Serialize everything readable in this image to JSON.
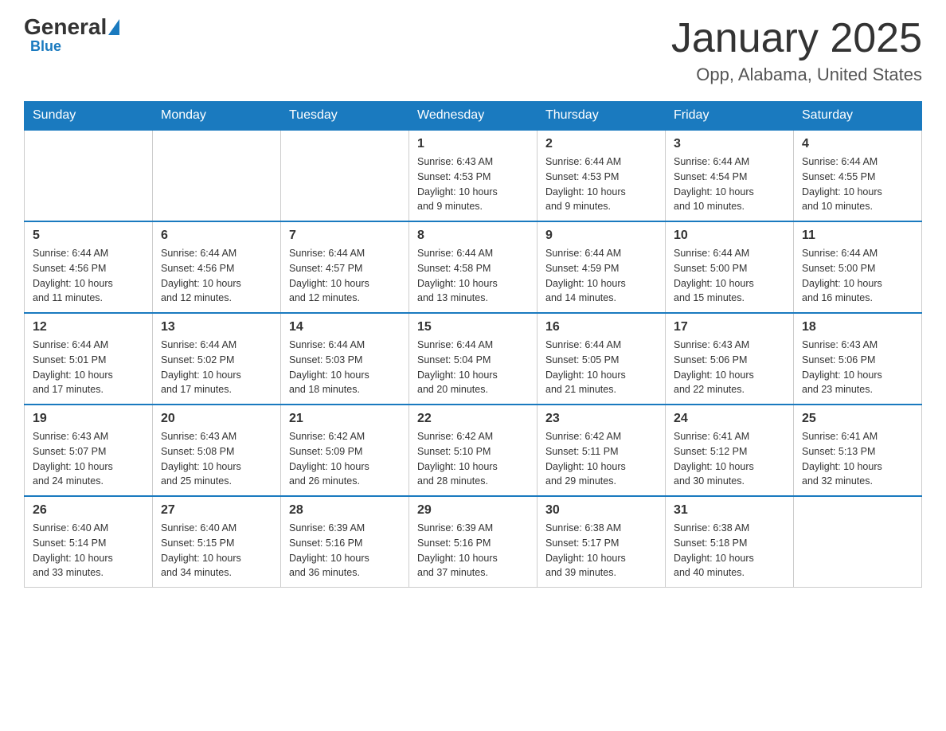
{
  "header": {
    "logo": {
      "general": "General",
      "blue": "Blue"
    },
    "title": "January 2025",
    "subtitle": "Opp, Alabama, United States"
  },
  "days_of_week": [
    "Sunday",
    "Monday",
    "Tuesday",
    "Wednesday",
    "Thursday",
    "Friday",
    "Saturday"
  ],
  "weeks": [
    [
      {
        "day": "",
        "info": ""
      },
      {
        "day": "",
        "info": ""
      },
      {
        "day": "",
        "info": ""
      },
      {
        "day": "1",
        "info": "Sunrise: 6:43 AM\nSunset: 4:53 PM\nDaylight: 10 hours\nand 9 minutes."
      },
      {
        "day": "2",
        "info": "Sunrise: 6:44 AM\nSunset: 4:53 PM\nDaylight: 10 hours\nand 9 minutes."
      },
      {
        "day": "3",
        "info": "Sunrise: 6:44 AM\nSunset: 4:54 PM\nDaylight: 10 hours\nand 10 minutes."
      },
      {
        "day": "4",
        "info": "Sunrise: 6:44 AM\nSunset: 4:55 PM\nDaylight: 10 hours\nand 10 minutes."
      }
    ],
    [
      {
        "day": "5",
        "info": "Sunrise: 6:44 AM\nSunset: 4:56 PM\nDaylight: 10 hours\nand 11 minutes."
      },
      {
        "day": "6",
        "info": "Sunrise: 6:44 AM\nSunset: 4:56 PM\nDaylight: 10 hours\nand 12 minutes."
      },
      {
        "day": "7",
        "info": "Sunrise: 6:44 AM\nSunset: 4:57 PM\nDaylight: 10 hours\nand 12 minutes."
      },
      {
        "day": "8",
        "info": "Sunrise: 6:44 AM\nSunset: 4:58 PM\nDaylight: 10 hours\nand 13 minutes."
      },
      {
        "day": "9",
        "info": "Sunrise: 6:44 AM\nSunset: 4:59 PM\nDaylight: 10 hours\nand 14 minutes."
      },
      {
        "day": "10",
        "info": "Sunrise: 6:44 AM\nSunset: 5:00 PM\nDaylight: 10 hours\nand 15 minutes."
      },
      {
        "day": "11",
        "info": "Sunrise: 6:44 AM\nSunset: 5:00 PM\nDaylight: 10 hours\nand 16 minutes."
      }
    ],
    [
      {
        "day": "12",
        "info": "Sunrise: 6:44 AM\nSunset: 5:01 PM\nDaylight: 10 hours\nand 17 minutes."
      },
      {
        "day": "13",
        "info": "Sunrise: 6:44 AM\nSunset: 5:02 PM\nDaylight: 10 hours\nand 17 minutes."
      },
      {
        "day": "14",
        "info": "Sunrise: 6:44 AM\nSunset: 5:03 PM\nDaylight: 10 hours\nand 18 minutes."
      },
      {
        "day": "15",
        "info": "Sunrise: 6:44 AM\nSunset: 5:04 PM\nDaylight: 10 hours\nand 20 minutes."
      },
      {
        "day": "16",
        "info": "Sunrise: 6:44 AM\nSunset: 5:05 PM\nDaylight: 10 hours\nand 21 minutes."
      },
      {
        "day": "17",
        "info": "Sunrise: 6:43 AM\nSunset: 5:06 PM\nDaylight: 10 hours\nand 22 minutes."
      },
      {
        "day": "18",
        "info": "Sunrise: 6:43 AM\nSunset: 5:06 PM\nDaylight: 10 hours\nand 23 minutes."
      }
    ],
    [
      {
        "day": "19",
        "info": "Sunrise: 6:43 AM\nSunset: 5:07 PM\nDaylight: 10 hours\nand 24 minutes."
      },
      {
        "day": "20",
        "info": "Sunrise: 6:43 AM\nSunset: 5:08 PM\nDaylight: 10 hours\nand 25 minutes."
      },
      {
        "day": "21",
        "info": "Sunrise: 6:42 AM\nSunset: 5:09 PM\nDaylight: 10 hours\nand 26 minutes."
      },
      {
        "day": "22",
        "info": "Sunrise: 6:42 AM\nSunset: 5:10 PM\nDaylight: 10 hours\nand 28 minutes."
      },
      {
        "day": "23",
        "info": "Sunrise: 6:42 AM\nSunset: 5:11 PM\nDaylight: 10 hours\nand 29 minutes."
      },
      {
        "day": "24",
        "info": "Sunrise: 6:41 AM\nSunset: 5:12 PM\nDaylight: 10 hours\nand 30 minutes."
      },
      {
        "day": "25",
        "info": "Sunrise: 6:41 AM\nSunset: 5:13 PM\nDaylight: 10 hours\nand 32 minutes."
      }
    ],
    [
      {
        "day": "26",
        "info": "Sunrise: 6:40 AM\nSunset: 5:14 PM\nDaylight: 10 hours\nand 33 minutes."
      },
      {
        "day": "27",
        "info": "Sunrise: 6:40 AM\nSunset: 5:15 PM\nDaylight: 10 hours\nand 34 minutes."
      },
      {
        "day": "28",
        "info": "Sunrise: 6:39 AM\nSunset: 5:16 PM\nDaylight: 10 hours\nand 36 minutes."
      },
      {
        "day": "29",
        "info": "Sunrise: 6:39 AM\nSunset: 5:16 PM\nDaylight: 10 hours\nand 37 minutes."
      },
      {
        "day": "30",
        "info": "Sunrise: 6:38 AM\nSunset: 5:17 PM\nDaylight: 10 hours\nand 39 minutes."
      },
      {
        "day": "31",
        "info": "Sunrise: 6:38 AM\nSunset: 5:18 PM\nDaylight: 10 hours\nand 40 minutes."
      },
      {
        "day": "",
        "info": ""
      }
    ]
  ]
}
